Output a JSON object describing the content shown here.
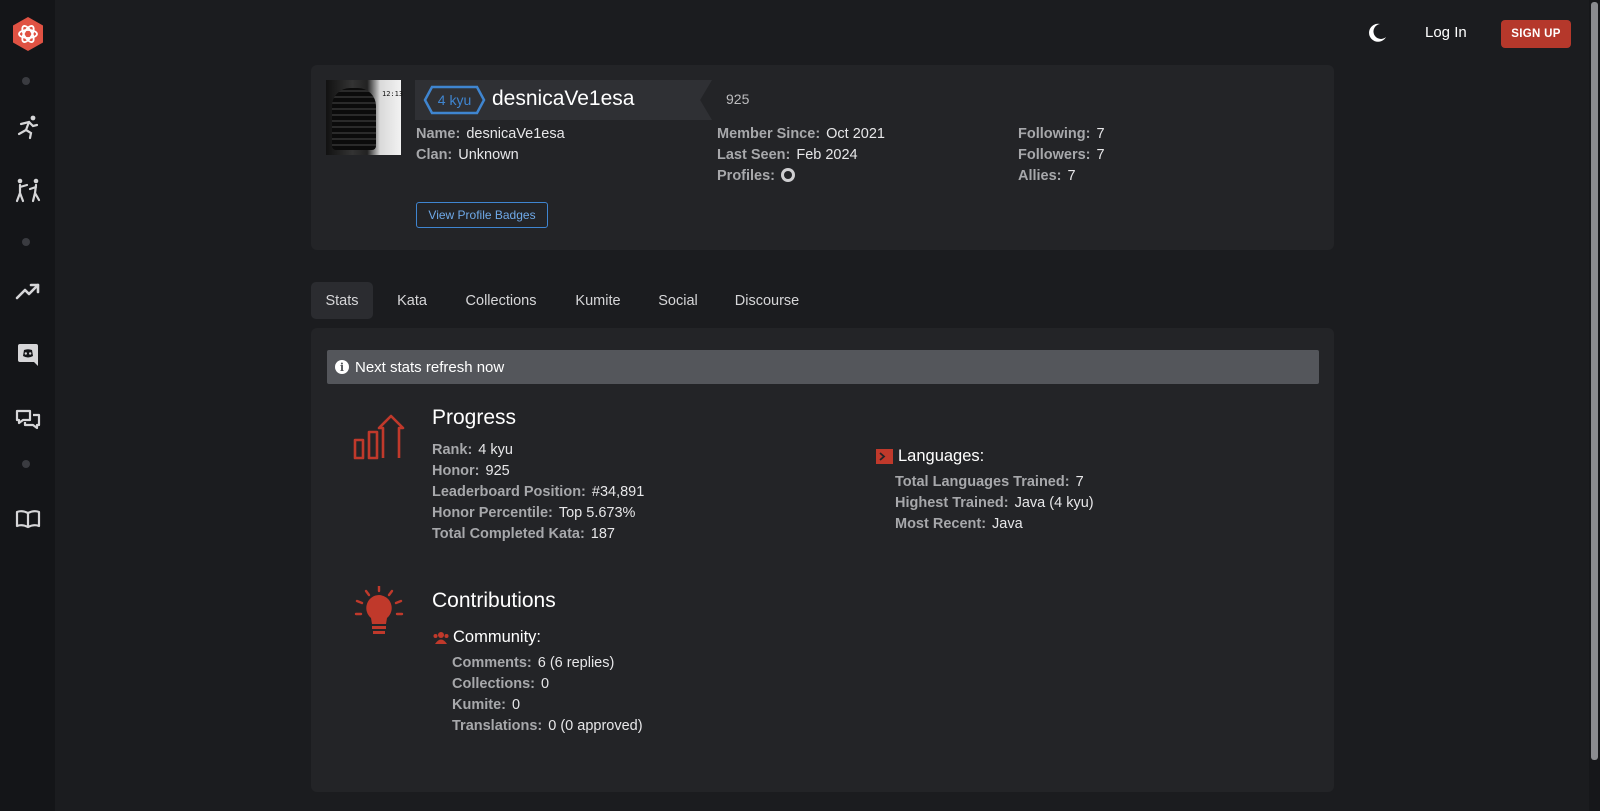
{
  "nav": {
    "logo_icon": "codewars-logo-icon",
    "items": [
      {
        "icon": "kata-runner-icon"
      },
      {
        "icon": "kumite-fighters-icon"
      },
      {
        "icon": "leaderboard-trend-icon"
      },
      {
        "icon": "discord-icon"
      },
      {
        "icon": "discussions-icon"
      },
      {
        "icon": "docs-book-icon"
      }
    ]
  },
  "topbar": {
    "theme_icon": "moon-icon",
    "login": "Log In",
    "signup": "SIGN UP"
  },
  "profile": {
    "rank": "4 kyu",
    "username": "desnicaVe1esa",
    "honor": "925",
    "name_label": "Name:",
    "name_value": "desnicaVe1esa",
    "clan_label": "Clan:",
    "clan_value": "Unknown",
    "member_since_label": "Member Since:",
    "member_since_value": "Oct 2021",
    "last_seen_label": "Last Seen:",
    "last_seen_value": "Feb 2024",
    "profiles_label": "Profiles:",
    "following_label": "Following:",
    "following_value": "7",
    "followers_label": "Followers:",
    "followers_value": "7",
    "allies_label": "Allies:",
    "allies_value": "7",
    "badges_button": "View Profile Badges",
    "avatar_tag": "12:13",
    "colors": {
      "rank_blue": "#3f85d0",
      "accent_red": "#b5382b"
    }
  },
  "tabs": [
    {
      "label": "Stats",
      "active": true
    },
    {
      "label": "Kata"
    },
    {
      "label": "Collections"
    },
    {
      "label": "Kumite"
    },
    {
      "label": "Social"
    },
    {
      "label": "Discourse"
    }
  ],
  "stats": {
    "notice": "Next stats refresh now",
    "progress": {
      "title": "Progress",
      "rows": [
        {
          "label": "Rank:",
          "value": "4 kyu"
        },
        {
          "label": "Honor:",
          "value": "925"
        },
        {
          "label": "Leaderboard Position:",
          "value": "#34,891"
        },
        {
          "label": "Honor Percentile:",
          "value": "Top 5.673%"
        },
        {
          "label": "Total Completed Kata:",
          "value": "187"
        }
      ]
    },
    "languages": {
      "title": "Languages:",
      "rows": [
        {
          "label": "Total Languages Trained:",
          "value": "7"
        },
        {
          "label": "Highest Trained:",
          "value": "Java (4 kyu)"
        },
        {
          "label": "Most Recent:",
          "value": "Java"
        }
      ]
    },
    "contributions": {
      "title": "Contributions",
      "community_title": "Community:",
      "rows": [
        {
          "label": "Comments:",
          "value": "6 (6 replies)"
        },
        {
          "label": "Collections:",
          "value": "0"
        },
        {
          "label": "Kumite:",
          "value": "0"
        },
        {
          "label": "Translations:",
          "value": "0 (0 approved)"
        }
      ]
    }
  }
}
